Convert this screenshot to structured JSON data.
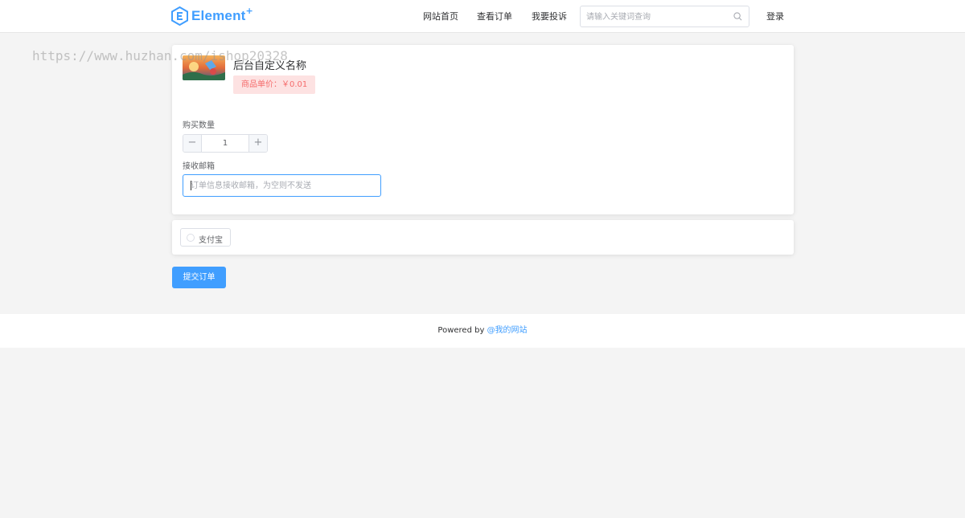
{
  "header": {
    "logo_text": "Element",
    "logo_plus": "+",
    "nav": {
      "home": "网站首页",
      "orders": "查看订单",
      "complain": "我要投诉",
      "login": "登录"
    },
    "search_placeholder": "请输入关键词查询"
  },
  "watermark": "https://www.huzhan.com/ishop20328",
  "product": {
    "name": "后台自定义名称",
    "price_label": "商品单价：￥0.01"
  },
  "form": {
    "qty_label": "购买数量",
    "qty_value": "1",
    "minus": "−",
    "plus": "+",
    "email_label": "接收邮箱",
    "email_placeholder": "订单信息接收邮箱，为空则不发送"
  },
  "payment": {
    "option_label": "支付宝"
  },
  "submit_label": "提交订单",
  "footer": {
    "prefix": "Powered by ",
    "link": "@我的网站"
  },
  "colors": {
    "primary": "#409eff",
    "price_bg": "#fde2e2",
    "price_text": "#f56c6c",
    "page_bg": "#f4f4f4"
  }
}
